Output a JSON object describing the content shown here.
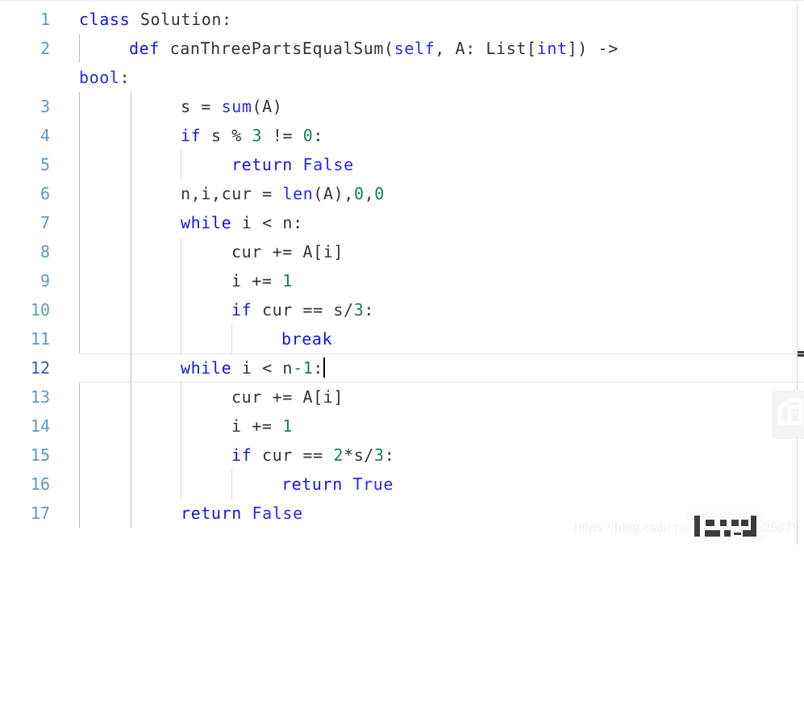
{
  "editor": {
    "language": "python",
    "active_line": 12,
    "caret_line": 12,
    "colors": {
      "background": "#ffffff",
      "keyword": "#1414e0",
      "builtin": "#2a2ae8",
      "number": "#108060",
      "plain": "#333333",
      "line_number": "#5b9bbd",
      "line_number_active": "#3a5fa8",
      "indent_guide": "#bfbfbf",
      "active_line_border": "#e4e4e4",
      "caret": "#000000",
      "watermark": "#efefef"
    },
    "lines": [
      {
        "number": "1",
        "text": "class Solution:"
      },
      {
        "number": "2",
        "text": "    def canThreePartsEqualSum(self, A: List[int]) -> bool:"
      },
      {
        "number": "3",
        "text": "        s = sum(A)"
      },
      {
        "number": "4",
        "text": "        if s % 3 != 0:"
      },
      {
        "number": "5",
        "text": "            return False"
      },
      {
        "number": "6",
        "text": "        n,i,cur = len(A),0,0"
      },
      {
        "number": "7",
        "text": "        while i < n:"
      },
      {
        "number": "8",
        "text": "            cur += A[i]"
      },
      {
        "number": "9",
        "text": "            i += 1"
      },
      {
        "number": "10",
        "text": "            if cur == s/3:"
      },
      {
        "number": "11",
        "text": "                break"
      },
      {
        "number": "12",
        "text": "        while i < n-1:"
      },
      {
        "number": "13",
        "text": "            cur += A[i]"
      },
      {
        "number": "14",
        "text": "            i += 1"
      },
      {
        "number": "15",
        "text": "            if cur == 2*s/3:"
      },
      {
        "number": "16",
        "text": "                return True"
      },
      {
        "number": "17",
        "text": "        return False"
      }
    ],
    "tokens": {
      "l1_kw": "class",
      "l1_rest": " Solution:",
      "l2_kw": "def",
      "l2_name": " canThreePartsEqualSum(",
      "l2_self": "self",
      "l2_sig": ", A: List[",
      "l2_int": "int",
      "l2_tail": "]) ->",
      "l2w_bool": "bool",
      "l2w_colon": ":",
      "l3_a": "s = ",
      "l3_sum": "sum",
      "l3_b": "(A)",
      "l4_if": "if",
      "l4_a": " s % ",
      "l4_3": "3",
      "l4_b": " != ",
      "l4_0": "0",
      "l4_c": ":",
      "l5_return": "return",
      "l5_false": " False",
      "l6_a": "n,i,cur = ",
      "l6_len": "len",
      "l6_b": "(A),",
      "l6_0a": "0",
      "l6_c": ",",
      "l6_0b": "0",
      "l7_while": "while",
      "l7_a": " i < n:",
      "l8_a": "cur += A[i]",
      "l9_a": "i += ",
      "l9_1": "1",
      "l10_if": "if",
      "l10_a": " cur == s/",
      "l10_3": "3",
      "l10_b": ":",
      "l11_break": "break",
      "l12_while": "while",
      "l12_a": " i < n",
      "l12_minus1": "-1",
      "l12_b": ":",
      "l13_a": "cur += A[i]",
      "l14_a": "i += ",
      "l14_1": "1",
      "l15_if": "if",
      "l15_a": " cur == ",
      "l15_2": "2",
      "l15_b": "*s/",
      "l15_3": "3",
      "l15_c": ":",
      "l16_return": "return",
      "l16_true": " True",
      "l17_return": "return",
      "l17_false": " False"
    }
  },
  "watermarks": {
    "url": "https://blog.csdn.net/weixin_39025679",
    "logo_name": "csdn-logo-watermark",
    "badge_name": "csdn-badge-watermark"
  }
}
